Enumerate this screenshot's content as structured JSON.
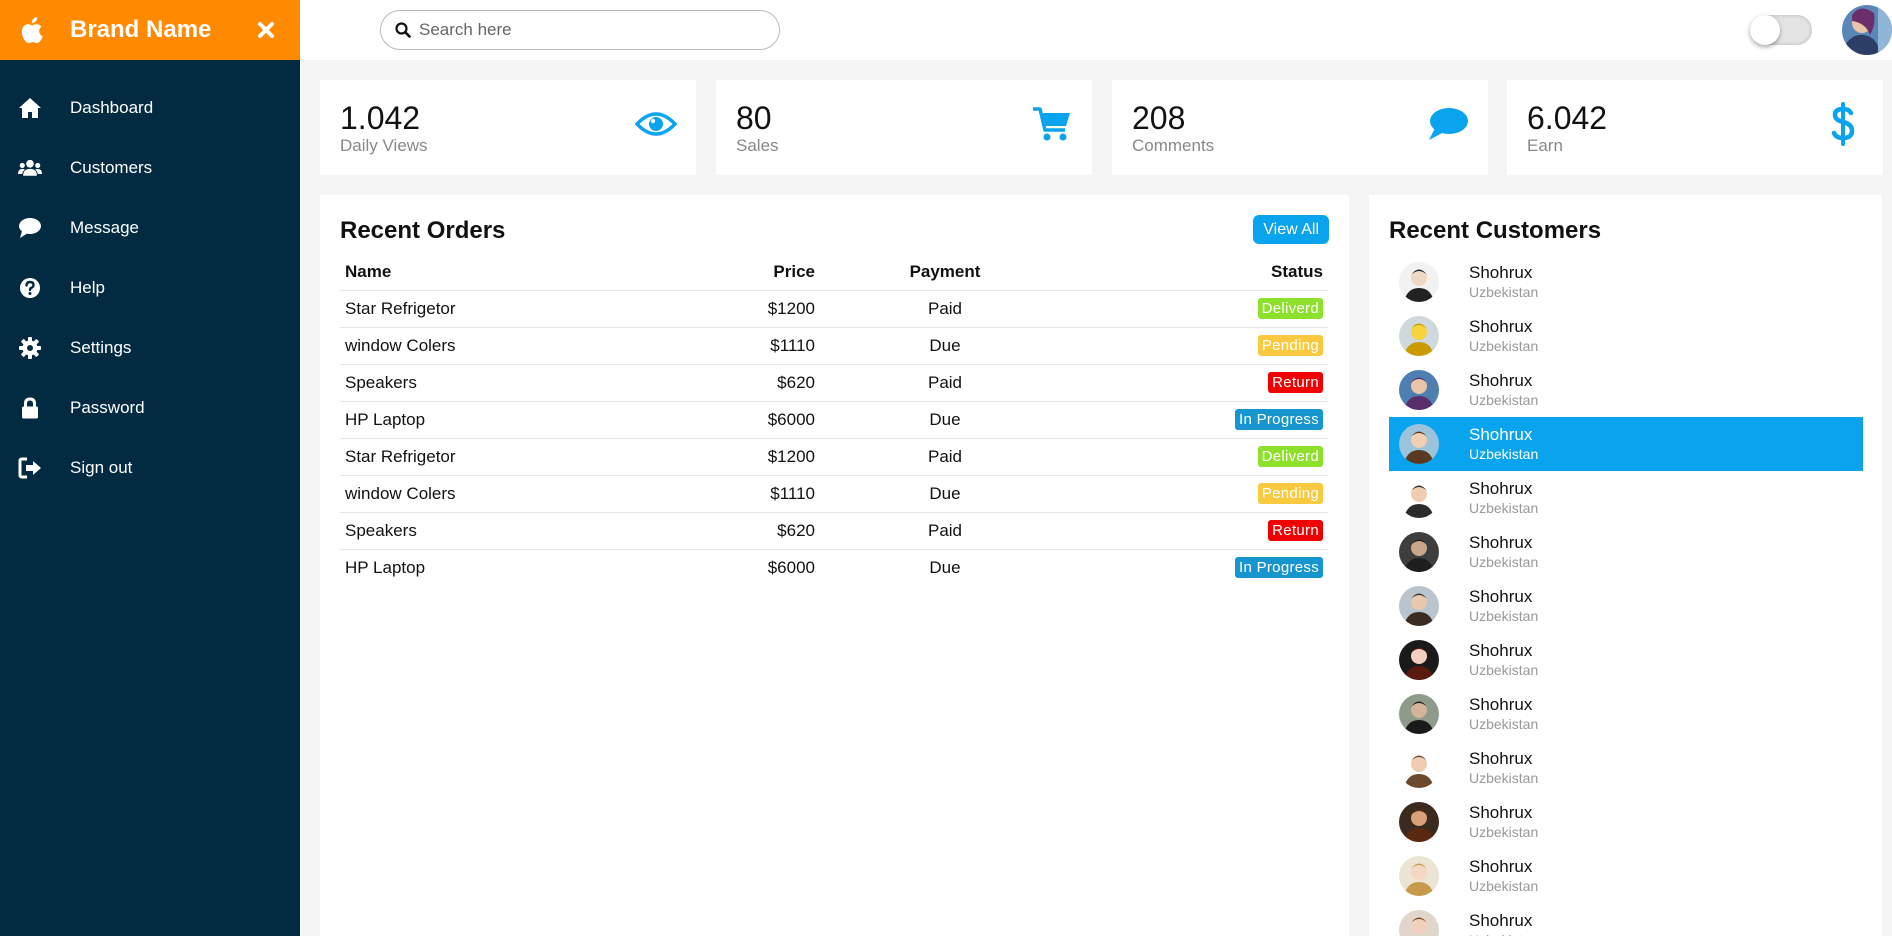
{
  "brand": {
    "name": "Brand Name",
    "logo_icon": "apple-icon",
    "close_icon": "close-icon",
    "color": "#ff8a00"
  },
  "sidebar": {
    "color": "#022b42",
    "items": [
      {
        "label": "Dashboard",
        "icon": "home-icon"
      },
      {
        "label": "Customers",
        "icon": "users-icon"
      },
      {
        "label": "Message",
        "icon": "chat-icon"
      },
      {
        "label": "Help",
        "icon": "help-icon"
      },
      {
        "label": "Settings",
        "icon": "gear-icon"
      },
      {
        "label": "Password",
        "icon": "lock-icon"
      },
      {
        "label": "Sign out",
        "icon": "sign-out-icon"
      }
    ]
  },
  "topbar": {
    "search_placeholder": "Search here",
    "toggle_on": false
  },
  "cards": [
    {
      "value": "1.042",
      "label": "Daily Views",
      "icon": "eye-icon"
    },
    {
      "value": "80",
      "label": "Sales",
      "icon": "cart-icon"
    },
    {
      "value": "208",
      "label": "Comments",
      "icon": "comment-icon"
    },
    {
      "value": "6.042",
      "label": "Earn",
      "icon": "dollar-icon"
    }
  ],
  "accent": "#0aa4ee",
  "orders": {
    "title": "Recent Orders",
    "view_all": "View All",
    "headers": {
      "name": "Name",
      "price": "Price",
      "payment": "Payment",
      "status": "Status"
    },
    "rows": [
      {
        "name": "Star Refrigetor",
        "price": "$1200",
        "payment": "Paid",
        "status": "Deliverd",
        "status_color": "#8de02c"
      },
      {
        "name": "window Colers",
        "price": "$1110",
        "payment": "Due",
        "status": "Pending",
        "status_color": "#f9ca3f"
      },
      {
        "name": "Speakers",
        "price": "$620",
        "payment": "Paid",
        "status": "Return",
        "status_color": "#f00000"
      },
      {
        "name": "HP Laptop",
        "price": "$6000",
        "payment": "Due",
        "status": "In Progress",
        "status_color": "#1795ce"
      },
      {
        "name": "Star Refrigetor",
        "price": "$1200",
        "payment": "Paid",
        "status": "Deliverd",
        "status_color": "#8de02c"
      },
      {
        "name": "window Colers",
        "price": "$1110",
        "payment": "Due",
        "status": "Pending",
        "status_color": "#f9ca3f"
      },
      {
        "name": "Speakers",
        "price": "$620",
        "payment": "Paid",
        "status": "Return",
        "status_color": "#f00000"
      },
      {
        "name": "HP Laptop",
        "price": "$6000",
        "payment": "Due",
        "status": "In Progress",
        "status_color": "#1795ce"
      }
    ]
  },
  "customers": {
    "title": "Recent Customers",
    "items": [
      {
        "name": "Shohrux",
        "country": "Uzbekistan",
        "active": false
      },
      {
        "name": "Shohrux",
        "country": "Uzbekistan",
        "active": false
      },
      {
        "name": "Shohrux",
        "country": "Uzbekistan",
        "active": false
      },
      {
        "name": "Shohrux",
        "country": "Uzbekistan",
        "active": true
      },
      {
        "name": "Shohrux",
        "country": "Uzbekistan",
        "active": false
      },
      {
        "name": "Shohrux",
        "country": "Uzbekistan",
        "active": false
      },
      {
        "name": "Shohrux",
        "country": "Uzbekistan",
        "active": false
      },
      {
        "name": "Shohrux",
        "country": "Uzbekistan",
        "active": false
      },
      {
        "name": "Shohrux",
        "country": "Uzbekistan",
        "active": false
      },
      {
        "name": "Shohrux",
        "country": "Uzbekistan",
        "active": false
      },
      {
        "name": "Shohrux",
        "country": "Uzbekistan",
        "active": false
      },
      {
        "name": "Shohrux",
        "country": "Uzbekistan",
        "active": false
      },
      {
        "name": "Shohrux",
        "country": "Uzbekistan",
        "active": false
      }
    ]
  }
}
